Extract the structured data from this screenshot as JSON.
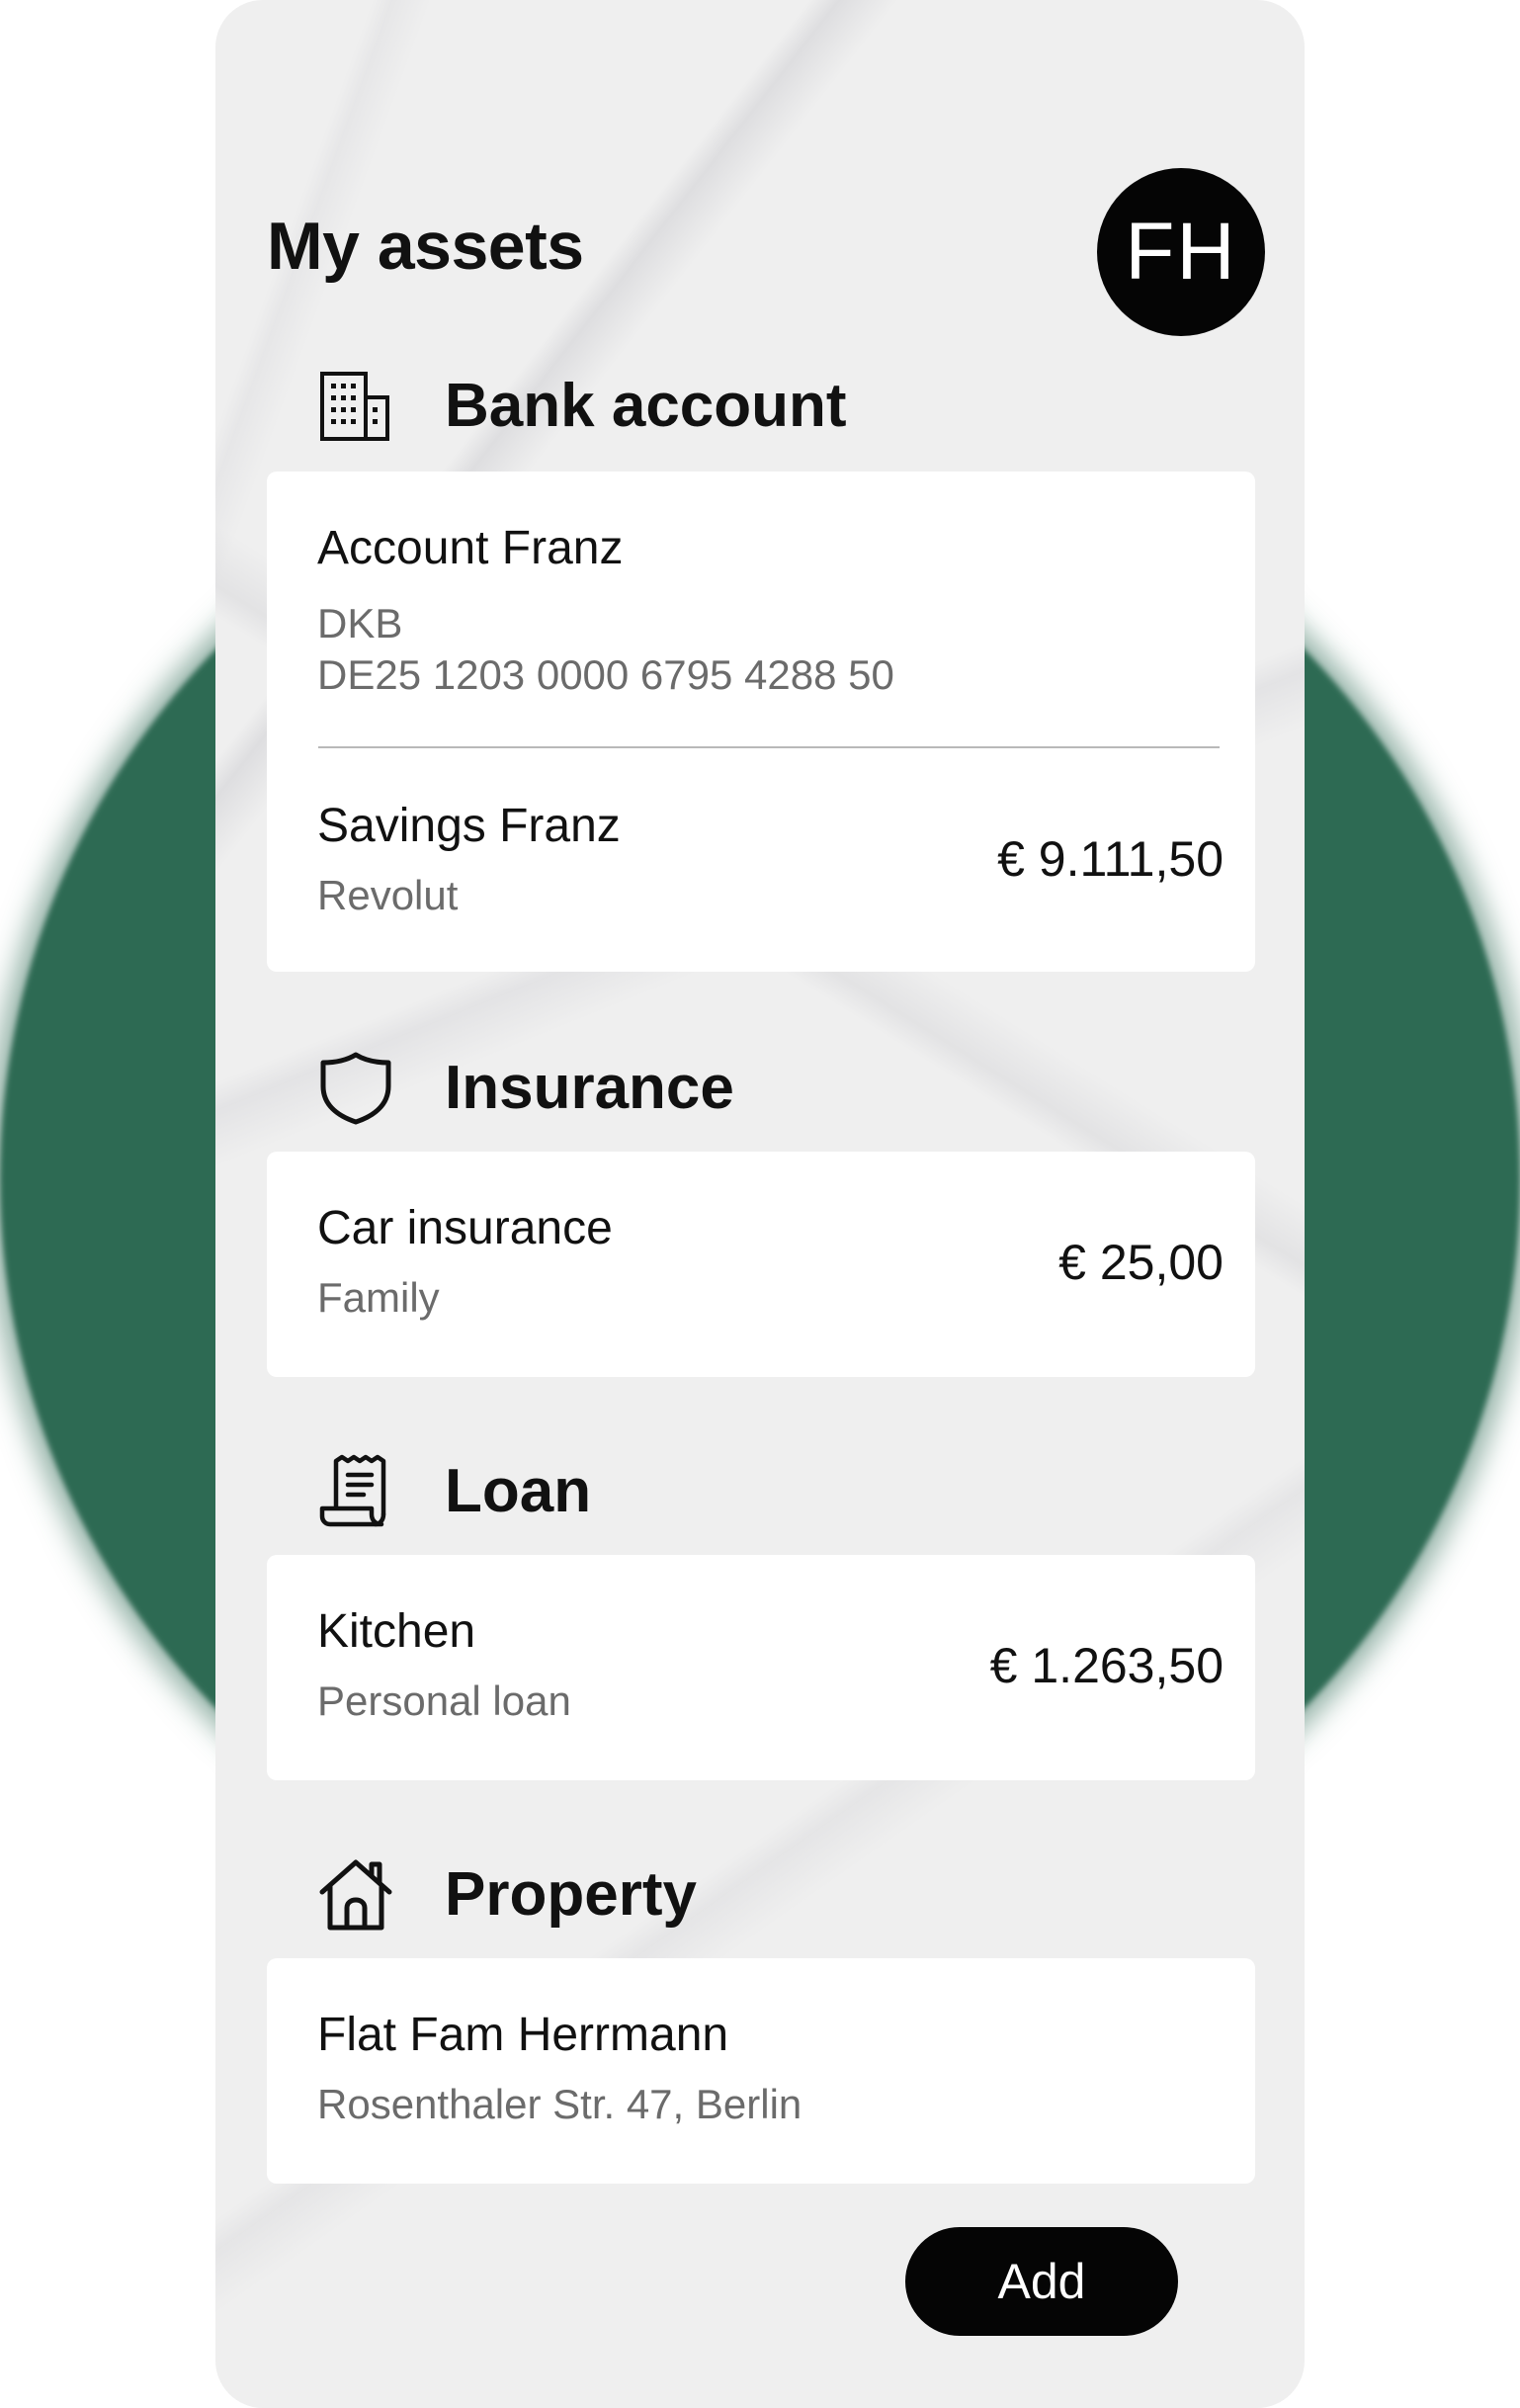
{
  "colors": {
    "accent_circle": "#2d6a53",
    "button": "#050505",
    "card": "#ffffff",
    "background": "#efefef"
  },
  "header": {
    "title": "My assets",
    "avatar_initials": "FH"
  },
  "sections": {
    "bank": {
      "title": "Bank account",
      "icon": "building-icon",
      "items": [
        {
          "name": "Account Franz",
          "sub1": "DKB",
          "sub2": "DE25 1203 0000 6795 4288 50",
          "amount": ""
        },
        {
          "name": "Savings Franz",
          "sub1": "Revolut",
          "amount": "€ 9.111,50"
        }
      ]
    },
    "insurance": {
      "title": "Insurance",
      "icon": "shield-icon",
      "items": [
        {
          "name": "Car insurance",
          "sub1": "Family",
          "amount": "€ 25,00"
        }
      ]
    },
    "loan": {
      "title": "Loan",
      "icon": "receipt-icon",
      "items": [
        {
          "name": "Kitchen",
          "sub1": "Personal loan",
          "amount": "€ 1.263,50"
        }
      ]
    },
    "property": {
      "title": "Property",
      "icon": "house-icon",
      "items": [
        {
          "name": "Flat Fam Herrmann",
          "sub1": "Rosenthaler Str. 47, Berlin",
          "amount": ""
        }
      ]
    }
  },
  "actions": {
    "add_label": "Add"
  }
}
